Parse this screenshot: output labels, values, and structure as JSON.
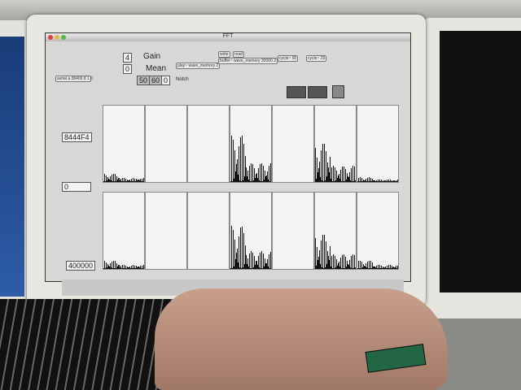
{
  "window": {
    "title": "FFT"
  },
  "controls": {
    "gain_value": "4",
    "gain_label": "Gain",
    "mean_value": "0",
    "mean_label": "Mean",
    "notch_50": "50",
    "notch_60": "60",
    "notch_value": "0",
    "notch_label": "Notch"
  },
  "objects": {
    "play": "play~ wave_memory 2",
    "buffer": "buffer~ wave_memory 30000 2",
    "write": "write",
    "read": "read",
    "cycle1": "cycle~ 95",
    "cycle2": "cycle~ 29",
    "serial": "serial a 38400 8 1 0"
  },
  "readouts": {
    "hex": "8444F4",
    "zero": "0",
    "large": "400000"
  },
  "spectra": {
    "top": [
      0.1,
      0,
      0,
      0.6,
      0,
      0.5,
      0.05
    ],
    "bottom": [
      0.1,
      0,
      0,
      0.55,
      0,
      0.45,
      0.1
    ]
  }
}
